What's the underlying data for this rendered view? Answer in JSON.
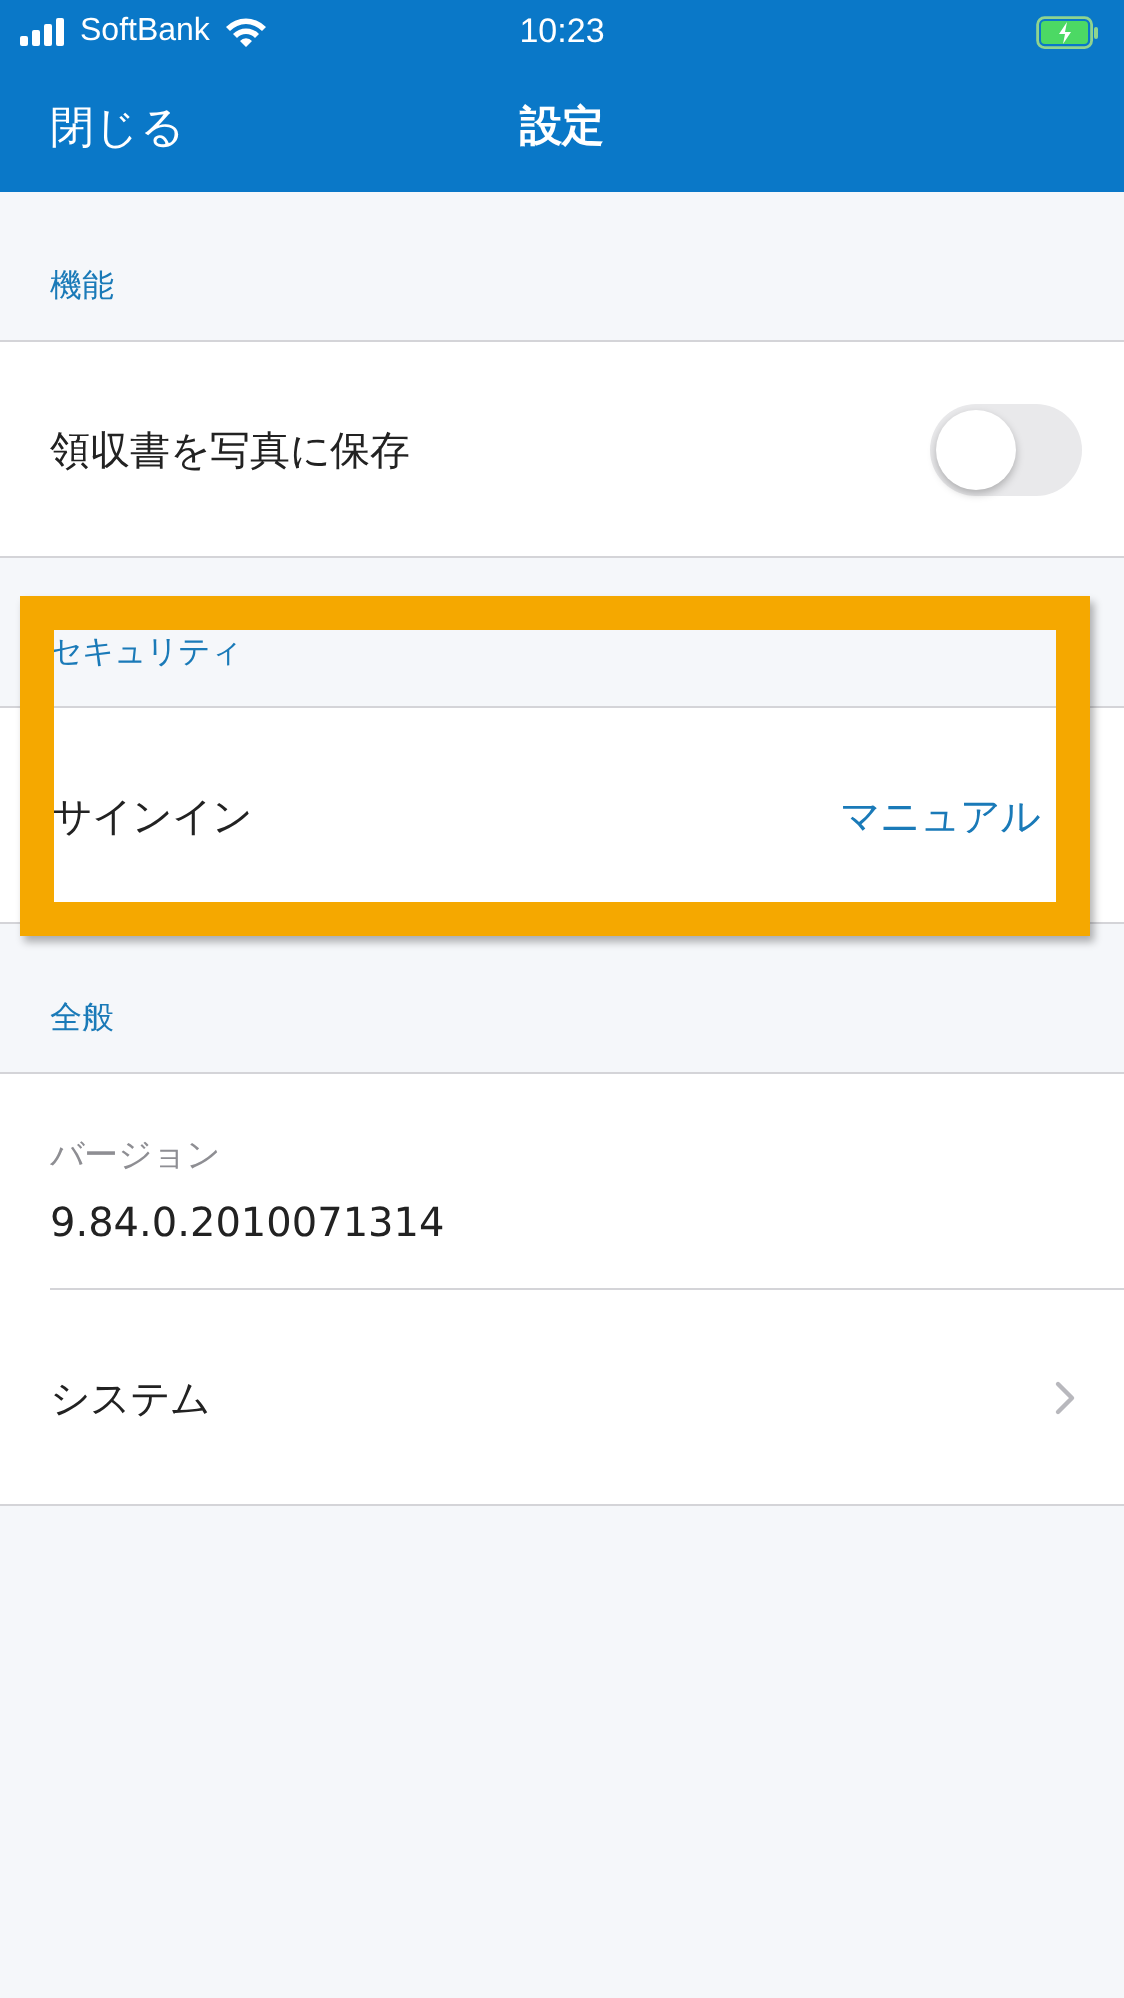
{
  "status_bar": {
    "carrier": "SoftBank",
    "time": "10:23"
  },
  "nav": {
    "close": "閉じる",
    "title": "設定"
  },
  "sections": [
    {
      "title": "機能",
      "highlighted": false,
      "rows": [
        {
          "kind": "toggle",
          "label": "領収書を写真に保存",
          "on": false
        }
      ]
    },
    {
      "title": "セキュリティ",
      "highlighted": true,
      "rows": [
        {
          "kind": "value",
          "label": "サインイン",
          "value": "マニュアル"
        }
      ]
    },
    {
      "title": "全般",
      "highlighted": false,
      "rows": [
        {
          "kind": "info",
          "label": "バージョン",
          "value": "9.84.0.2010071314"
        },
        {
          "kind": "nav",
          "label": "システム"
        }
      ]
    }
  ]
}
